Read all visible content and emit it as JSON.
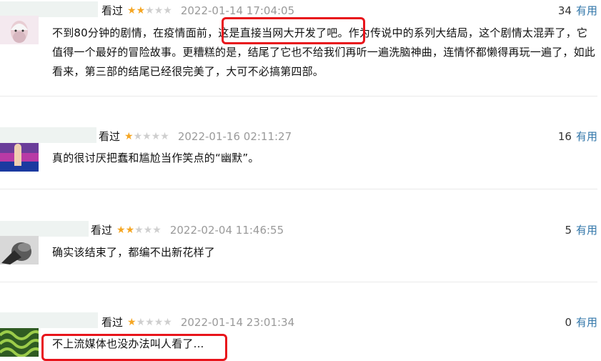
{
  "reviews": [
    {
      "status": "看过",
      "rating": 2,
      "time": "2022-01-14 17:04:05",
      "votes": "34",
      "useful_label": "有用",
      "text": "不到80分钟的剧情，在疫情面前，这是直接当网大开发了吧。作为传说中的系列大结局，这个剧情太混弄了，它值得一个最好的冒险故事。更糟糕的是，结尾了它也不给我们再听一遍洗脑神曲，连情怀都懒得再玩一遍了，如此看来，第三部的结尾已经很完美了，大可不必搞第四部。"
    },
    {
      "status": "看过",
      "rating": 1,
      "time": "2022-01-16 02:11:27",
      "votes": "16",
      "useful_label": "有用",
      "text": "真的很讨厌把蠢和尴尬当作笑点的“幽默”。"
    },
    {
      "status": "看过",
      "rating": 2,
      "time": "2022-02-04 11:46:55",
      "votes": "5",
      "useful_label": "有用",
      "text": "确实该结束了，都编不出新花样了"
    },
    {
      "status": "看过",
      "rating": 1,
      "time": "2022-01-14 23:01:34",
      "votes": "0",
      "useful_label": "有用",
      "text": "不上流媒体也没办法叫人看了..."
    }
  ],
  "colors": {
    "highlight": "#e8141b",
    "star_on": "#f5a623",
    "link": "#3377aa"
  }
}
